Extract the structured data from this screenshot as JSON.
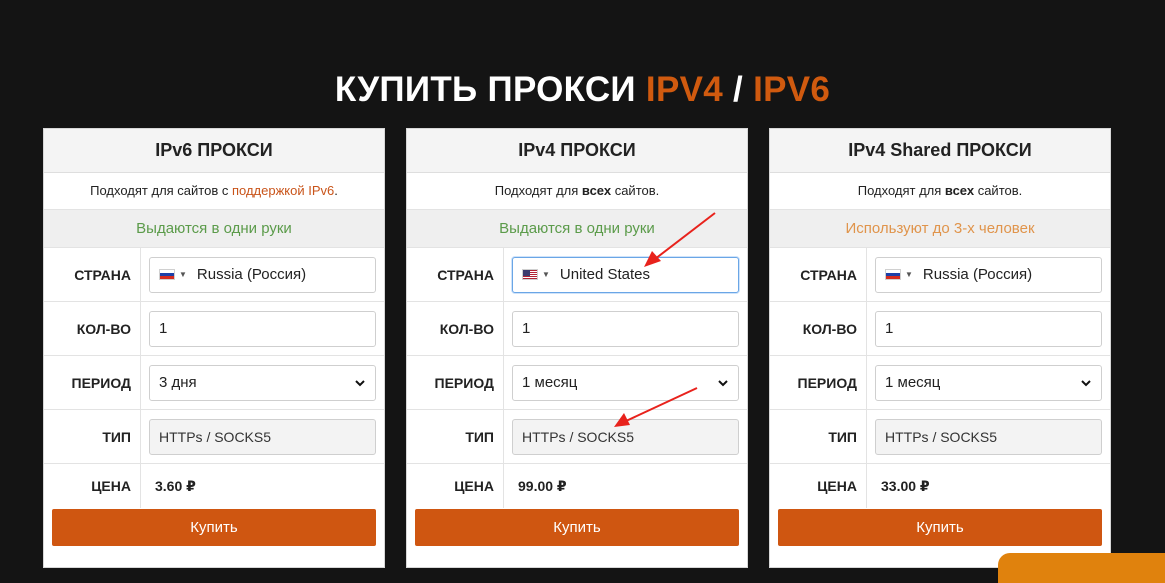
{
  "page": {
    "title_main": "КУПИТЬ ПРОКСИ ",
    "title_ipv4": "IPV4",
    "title_sep": " / ",
    "title_ipv6": "IPV6"
  },
  "labels": {
    "country": "СТРАНА",
    "qty": "КОЛ-ВО",
    "period": "ПЕРИОД",
    "type": "ТИП",
    "price": "ЦЕНА"
  },
  "cards": [
    {
      "title": "IPv6 ПРОКСИ",
      "desc_prefix": "Подходят для сайтов с ",
      "desc_link": "поддержкой IPv6",
      "desc_suffix": ".",
      "status": "Выдаются в одни руки",
      "status_color": "#5b9b4a",
      "country_flag": "ru-flag-icon",
      "country": "Russia (Россия)",
      "qty": "1",
      "period": "3 дня",
      "type": "HTTPs / SOCKS5",
      "price": "3.60 ₽",
      "buy": "Купить"
    },
    {
      "title": "IPv4 ПРОКСИ",
      "desc_prefix": "Подходят для ",
      "desc_bold": "всех",
      "desc_suffix": " сайтов.",
      "status": "Выдаются в одни руки",
      "status_color": "#5b9b4a",
      "country_flag": "us-flag-icon",
      "country": "United States",
      "qty": "1",
      "period": "1 месяц",
      "type": "HTTPs / SOCKS5",
      "price": "99.00 ₽",
      "buy": "Купить"
    },
    {
      "title": "IPv4 Shared ПРОКСИ",
      "desc_prefix": "Подходят для ",
      "desc_bold": "всех",
      "desc_suffix": " сайтов.",
      "status": "Используют до 3-х человек",
      "status_color": "#e0944b",
      "country_flag": "ru-flag-icon",
      "country": "Russia (Россия)",
      "qty": "1",
      "period": "1 месяц",
      "type": "HTTPs / SOCKS5",
      "price": "33.00 ₽",
      "buy": "Купить"
    }
  ],
  "colors": {
    "accent": "#d05a0f",
    "button": "#cf5611",
    "annotation_arrow": "#e8221c"
  }
}
